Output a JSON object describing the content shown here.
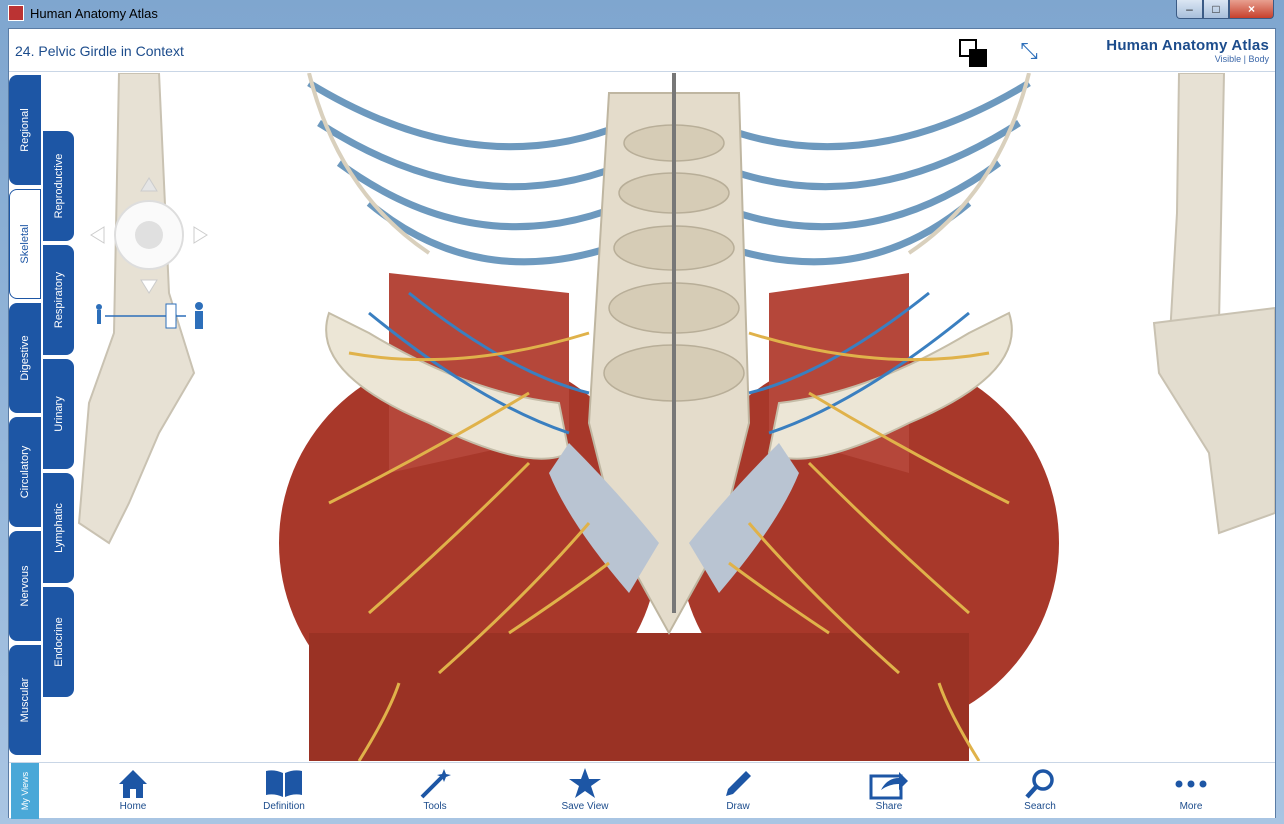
{
  "window": {
    "title": "Human Anatomy Atlas",
    "controls": {
      "minimize": "–",
      "maximize": "□",
      "close": "×"
    }
  },
  "header": {
    "page_title": "24. Pelvic Girdle in Context",
    "brand_name": "Human Anatomy Atlas",
    "brand_sub": "Visible | Body"
  },
  "left_tabs": [
    {
      "label": "Regional",
      "active": false
    },
    {
      "label": "Skeletal",
      "active": true
    },
    {
      "label": "Digestive",
      "active": false
    },
    {
      "label": "Circulatory",
      "active": false
    },
    {
      "label": "Nervous",
      "active": false
    },
    {
      "label": "Muscular",
      "active": false
    }
  ],
  "right_tabs": [
    {
      "label": "Reproductive"
    },
    {
      "label": "Respiratory"
    },
    {
      "label": "Urinary"
    },
    {
      "label": "Lymphatic"
    },
    {
      "label": "Endocrine"
    }
  ],
  "footer": {
    "my_views_label": "My Views",
    "tools": [
      {
        "label": "Home",
        "icon": "home-icon"
      },
      {
        "label": "Definition",
        "icon": "book-icon"
      },
      {
        "label": "Tools",
        "icon": "wand-icon"
      },
      {
        "label": "Save View",
        "icon": "star-icon"
      },
      {
        "label": "Draw",
        "icon": "pencil-icon"
      },
      {
        "label": "Share",
        "icon": "share-icon"
      },
      {
        "label": "Search",
        "icon": "search-icon"
      },
      {
        "label": "More",
        "icon": "more-icon"
      }
    ]
  },
  "colors": {
    "accent": "#1d56a5",
    "muscle": "#a8382a",
    "bone": "#e8e2d2",
    "nerve": "#e0b24a",
    "vessel": "#3a7fc0"
  }
}
